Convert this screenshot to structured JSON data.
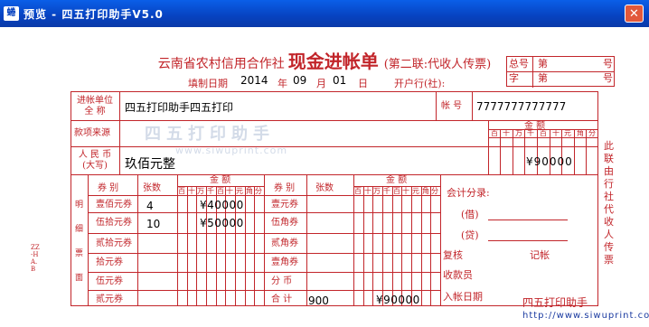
{
  "window": {
    "icon_text": "蜷",
    "title": "预览 - 四五打印助手V5.0",
    "close_symbol": "✕"
  },
  "form": {
    "bank_name": "云南省农村信用合作社",
    "form_name": "现金进帐单",
    "copy_note": "(第二联:代收人传票)",
    "corner": {
      "label1": "总号",
      "label2": "字",
      "num1": "第",
      "num2": "第",
      "suffix1": "号",
      "suffix2": "号"
    },
    "fill_date_label": "填制日期",
    "year": "2014",
    "year_unit": "年",
    "month": "09",
    "month_unit": "月",
    "day": "01",
    "day_unit": "日",
    "bank_label": "开户行(社):",
    "payee_unit_label": "进帐单位 全 称",
    "payee_unit_value": "四五打印助手四五打印",
    "account_label": "帐 号",
    "account_value": "7777777777777",
    "source_label": "款项来源",
    "rmb_label": "人 民 币 (大写)",
    "rmb_value": "玖佰元整",
    "amount_label": "金 额",
    "amount_digits": "¥90000",
    "digit_units": [
      "百",
      "十",
      "万",
      "千",
      "百",
      "十",
      "元",
      "角",
      "分"
    ],
    "detail_vertical": "明细票面",
    "left_header": {
      "type": "券 别",
      "count": "张数",
      "amount": "金 额"
    },
    "left_rows": [
      {
        "name": "壹佰元券",
        "count": "4",
        "amount": "¥40000"
      },
      {
        "name": "伍拾元券",
        "count": "10",
        "amount": "¥50000"
      },
      {
        "name": "贰拾元券",
        "count": "",
        "amount": ""
      },
      {
        "name": "拾元券",
        "count": "",
        "amount": ""
      },
      {
        "name": "伍元券",
        "count": "",
        "amount": ""
      },
      {
        "name": "贰元券",
        "count": "",
        "amount": ""
      }
    ],
    "right_header": {
      "type": "券 别",
      "count": "张数",
      "amount": "金 额"
    },
    "right_rows": [
      {
        "name": "壹元券",
        "count": "",
        "amount": ""
      },
      {
        "name": "伍角券",
        "count": "",
        "amount": ""
      },
      {
        "name": "贰角券",
        "count": "",
        "amount": ""
      },
      {
        "name": "壹角券",
        "count": "",
        "amount": ""
      },
      {
        "name": "分 币",
        "count": "",
        "amount": ""
      },
      {
        "name": "合 计",
        "count": "900",
        "amount": "¥90000"
      }
    ],
    "accounting_label": "会计分录:",
    "debit_label": "(借)",
    "credit_label": "(贷)",
    "review_label": "复核",
    "bookkeeper_label": "记帐",
    "cashier_label": "收款员",
    "entry_date_label": "入帐日期",
    "side_note": "此联由行社代收人传票",
    "left_margin_code": "ZZ-HA.B",
    "watermark": "四五打印助手",
    "watermark_url": "www.siwuprint.com"
  },
  "footer": {
    "brand": "四五打印助手",
    "site": "http://www.siwuprint.com"
  }
}
